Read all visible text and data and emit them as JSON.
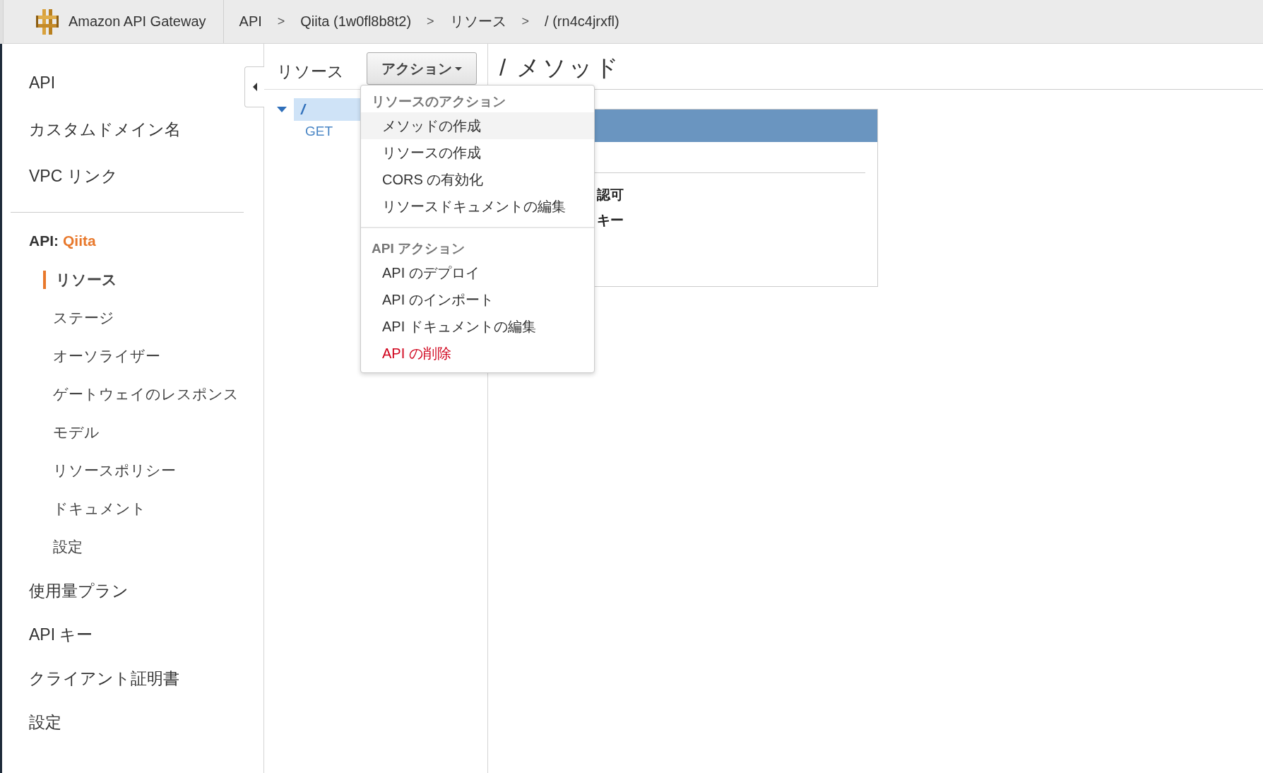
{
  "header": {
    "logo": "Amazon API Gateway",
    "breadcrumb": [
      {
        "kind": "link",
        "text": "API"
      },
      {
        "kind": "separator",
        "text": ">"
      },
      {
        "kind": "link",
        "text": "Qiita (1w0fl8b8t2)"
      },
      {
        "kind": "separator",
        "text": ">"
      },
      {
        "kind": "link",
        "text": "リソース"
      },
      {
        "kind": "separator",
        "text": ">"
      },
      {
        "kind": "link",
        "text": "/ (rn4c4jrxfl)"
      }
    ]
  },
  "sidebar": {
    "top_items": [
      {
        "label": "API"
      },
      {
        "label": "カスタムドメイン名"
      },
      {
        "label": "VPC リンク"
      }
    ],
    "api_section": {
      "prefix": "API:",
      "name": "Qiita",
      "items": [
        {
          "label": "リソース",
          "selected": true
        },
        {
          "label": "ステージ",
          "selected": false
        },
        {
          "label": "オーソライザー",
          "selected": false
        },
        {
          "label": "ゲートウェイのレスポンス",
          "selected": false
        },
        {
          "label": "モデル",
          "selected": false
        },
        {
          "label": "リソースポリシー",
          "selected": false
        },
        {
          "label": "ドキュメント",
          "selected": false
        },
        {
          "label": "設定",
          "selected": false
        }
      ]
    },
    "bottom_items": [
      {
        "label": "使用量プラン"
      },
      {
        "label": "API キー"
      },
      {
        "label": "クライアント証明書"
      },
      {
        "label": "設定"
      }
    ]
  },
  "resources": {
    "title": "リソース",
    "action_button": "アクション",
    "tree": [
      {
        "label": "/",
        "selected": true,
        "expanded": true,
        "children": [
          {
            "label": "GET",
            "selected": false
          }
        ]
      }
    ]
  },
  "actions_menu": {
    "sections": [
      {
        "heading": "リソースのアクション",
        "items": [
          {
            "label": "メソッドの作成",
            "highlighted": true,
            "kind": "normal"
          },
          {
            "label": "リソースの作成",
            "highlighted": false,
            "kind": "normal"
          },
          {
            "label": "CORS の有効化",
            "highlighted": false,
            "kind": "normal"
          },
          {
            "label": "リソースドキュメントの編集",
            "highlighted": false,
            "kind": "normal"
          }
        ]
      },
      {
        "heading": "API アクション",
        "items": [
          {
            "label": "API のデプロイ",
            "highlighted": false,
            "kind": "normal"
          },
          {
            "label": "API のインポート",
            "highlighted": false,
            "kind": "normal"
          },
          {
            "label": "API ドキュメントの編集",
            "highlighted": false,
            "kind": "normal"
          },
          {
            "label": "API の削除",
            "highlighted": false,
            "kind": "danger"
          }
        ]
      }
    ]
  },
  "methods": {
    "title": "/ メソッド",
    "panel_texts": [
      "認可",
      "キー"
    ]
  }
}
